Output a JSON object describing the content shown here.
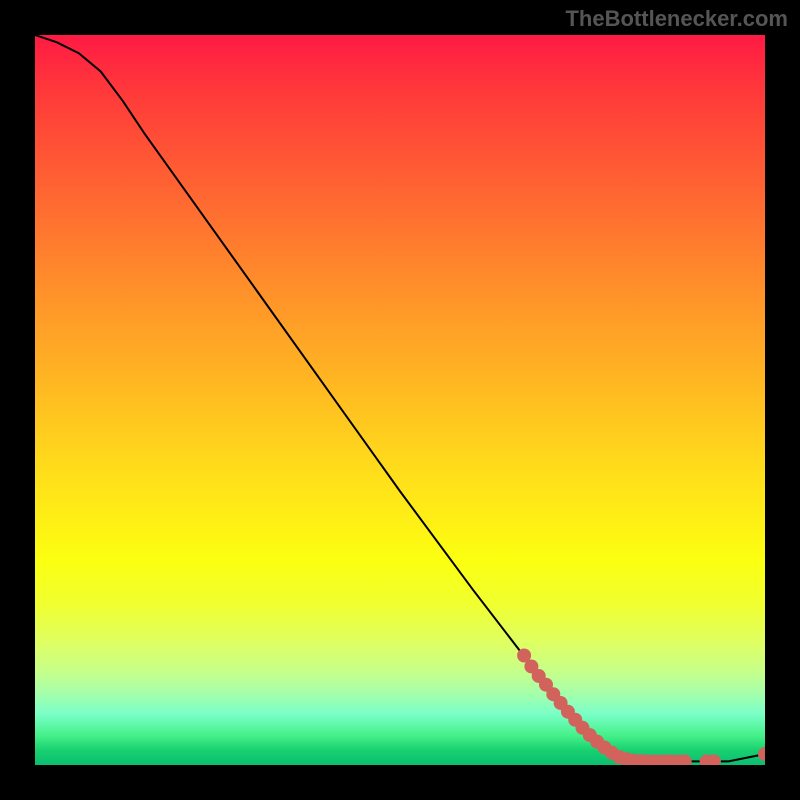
{
  "attribution": "TheBottlenecker.com",
  "chart_data": {
    "type": "line",
    "title": "",
    "xlabel": "",
    "ylabel": "",
    "xlim": [
      0,
      100
    ],
    "ylim": [
      0,
      100
    ],
    "grid": false,
    "curve": [
      {
        "x": 0,
        "y": 100
      },
      {
        "x": 3,
        "y": 99
      },
      {
        "x": 6,
        "y": 97.5
      },
      {
        "x": 9,
        "y": 95
      },
      {
        "x": 12,
        "y": 91
      },
      {
        "x": 15,
        "y": 86.5
      },
      {
        "x": 20,
        "y": 79.5
      },
      {
        "x": 30,
        "y": 65.5
      },
      {
        "x": 40,
        "y": 51.5
      },
      {
        "x": 50,
        "y": 37.5
      },
      {
        "x": 60,
        "y": 24
      },
      {
        "x": 70,
        "y": 11
      },
      {
        "x": 75,
        "y": 5
      },
      {
        "x": 78,
        "y": 2
      },
      {
        "x": 80,
        "y": 1
      },
      {
        "x": 85,
        "y": 0.5
      },
      {
        "x": 90,
        "y": 0.5
      },
      {
        "x": 95,
        "y": 0.5
      },
      {
        "x": 100,
        "y": 1.5
      }
    ],
    "scatter_points": [
      {
        "x": 67,
        "y": 15
      },
      {
        "x": 68,
        "y": 13.5
      },
      {
        "x": 69,
        "y": 12.2
      },
      {
        "x": 70,
        "y": 11
      },
      {
        "x": 71,
        "y": 9.7
      },
      {
        "x": 72,
        "y": 8.5
      },
      {
        "x": 73,
        "y": 7.3
      },
      {
        "x": 74,
        "y": 6.2
      },
      {
        "x": 75,
        "y": 5.1
      },
      {
        "x": 76,
        "y": 4.1
      },
      {
        "x": 77,
        "y": 3.2
      },
      {
        "x": 78,
        "y": 2.4
      },
      {
        "x": 79,
        "y": 1.7
      },
      {
        "x": 80,
        "y": 1.1
      },
      {
        "x": 81,
        "y": 0.8
      },
      {
        "x": 82,
        "y": 0.6
      },
      {
        "x": 83,
        "y": 0.55
      },
      {
        "x": 84,
        "y": 0.5
      },
      {
        "x": 85,
        "y": 0.5
      },
      {
        "x": 86,
        "y": 0.5
      },
      {
        "x": 87,
        "y": 0.5
      },
      {
        "x": 88,
        "y": 0.5
      },
      {
        "x": 89,
        "y": 0.5
      },
      {
        "x": 92,
        "y": 0.5
      },
      {
        "x": 93,
        "y": 0.5
      },
      {
        "x": 100,
        "y": 1.5
      }
    ],
    "scatter_color": "#d1635c",
    "line_color": "#000000"
  }
}
